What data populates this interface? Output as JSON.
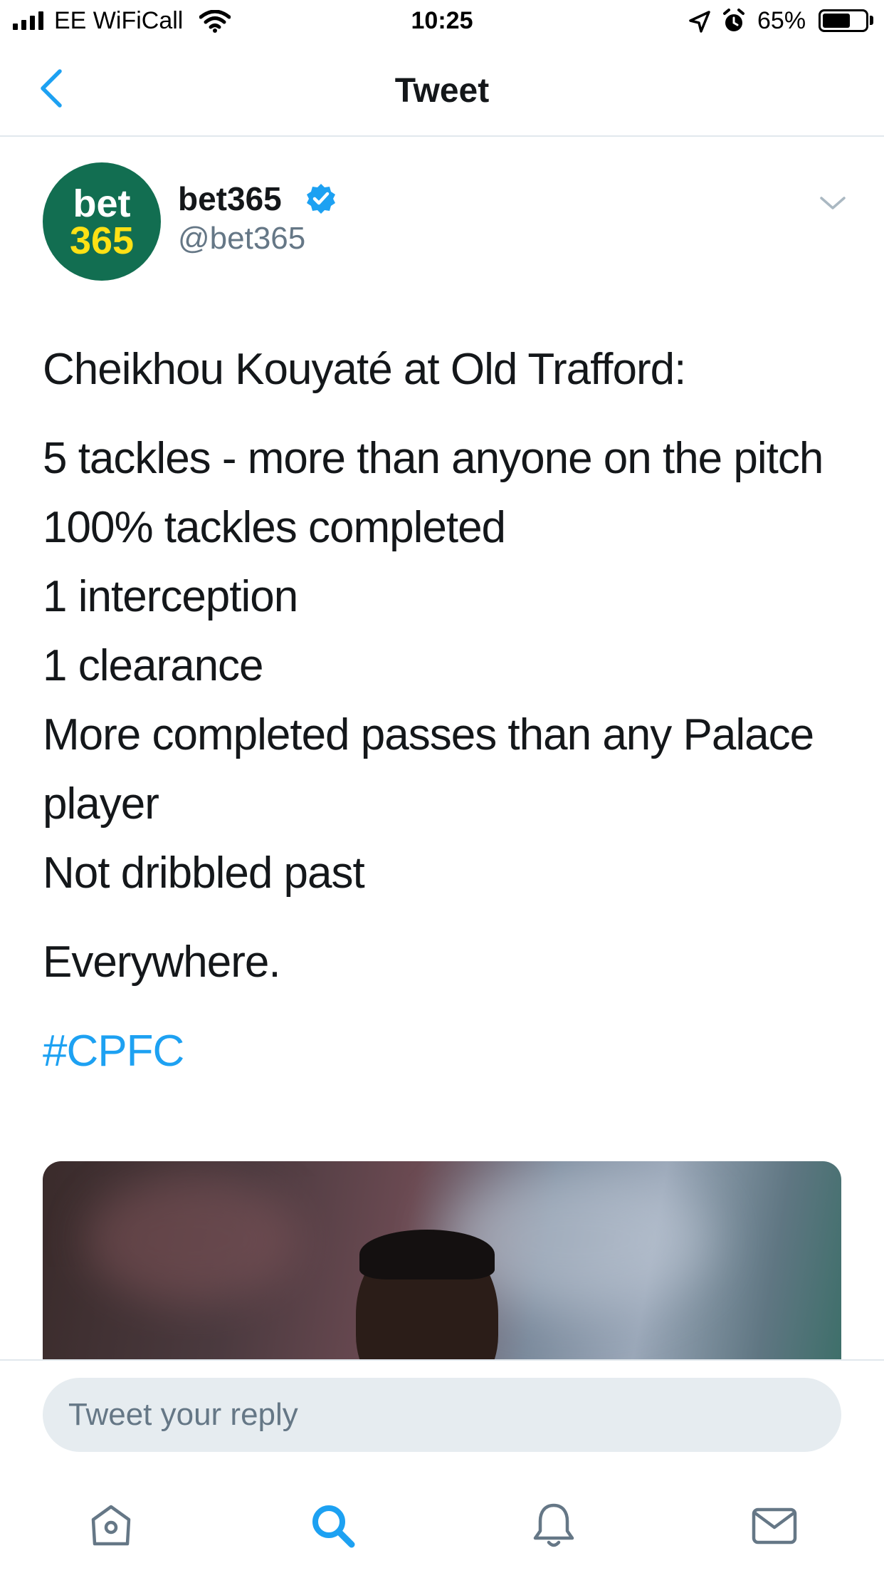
{
  "status_bar": {
    "carrier": "EE WiFiCall",
    "time": "10:25",
    "battery_percent": "65%",
    "battery_level": 0.65,
    "icons": [
      "signal-icon",
      "wifi-icon",
      "location-icon",
      "alarm-icon",
      "battery-icon"
    ]
  },
  "nav": {
    "title": "Tweet",
    "back_icon": "chevron-left-icon"
  },
  "tweet": {
    "avatar": {
      "line1": "bet",
      "line2": "365"
    },
    "display_name": "bet365",
    "handle": "@bet365",
    "verified": true,
    "menu_icon": "chevron-down-icon",
    "paragraphs": [
      "Cheikhou Kouyaté at Old Trafford:",
      "5 tackles - more than anyone on the pitch\n100% tackles completed\n1 interception\n1 clearance\nMore completed passes than any Palace player\nNot dribbled past",
      "Everywhere."
    ],
    "hashtag": "#CPFC"
  },
  "reply": {
    "placeholder": "Tweet your reply"
  },
  "tabbar": {
    "items": [
      "home-icon",
      "search-icon",
      "notifications-icon",
      "messages-icon"
    ],
    "active": "search-icon"
  },
  "colors": {
    "accent": "#1da1f2",
    "text": "#14171a",
    "secondary": "#657786",
    "avatar_bg": "#126e51",
    "avatar_yellow": "#ffe115",
    "divider": "#e1e8ed"
  }
}
